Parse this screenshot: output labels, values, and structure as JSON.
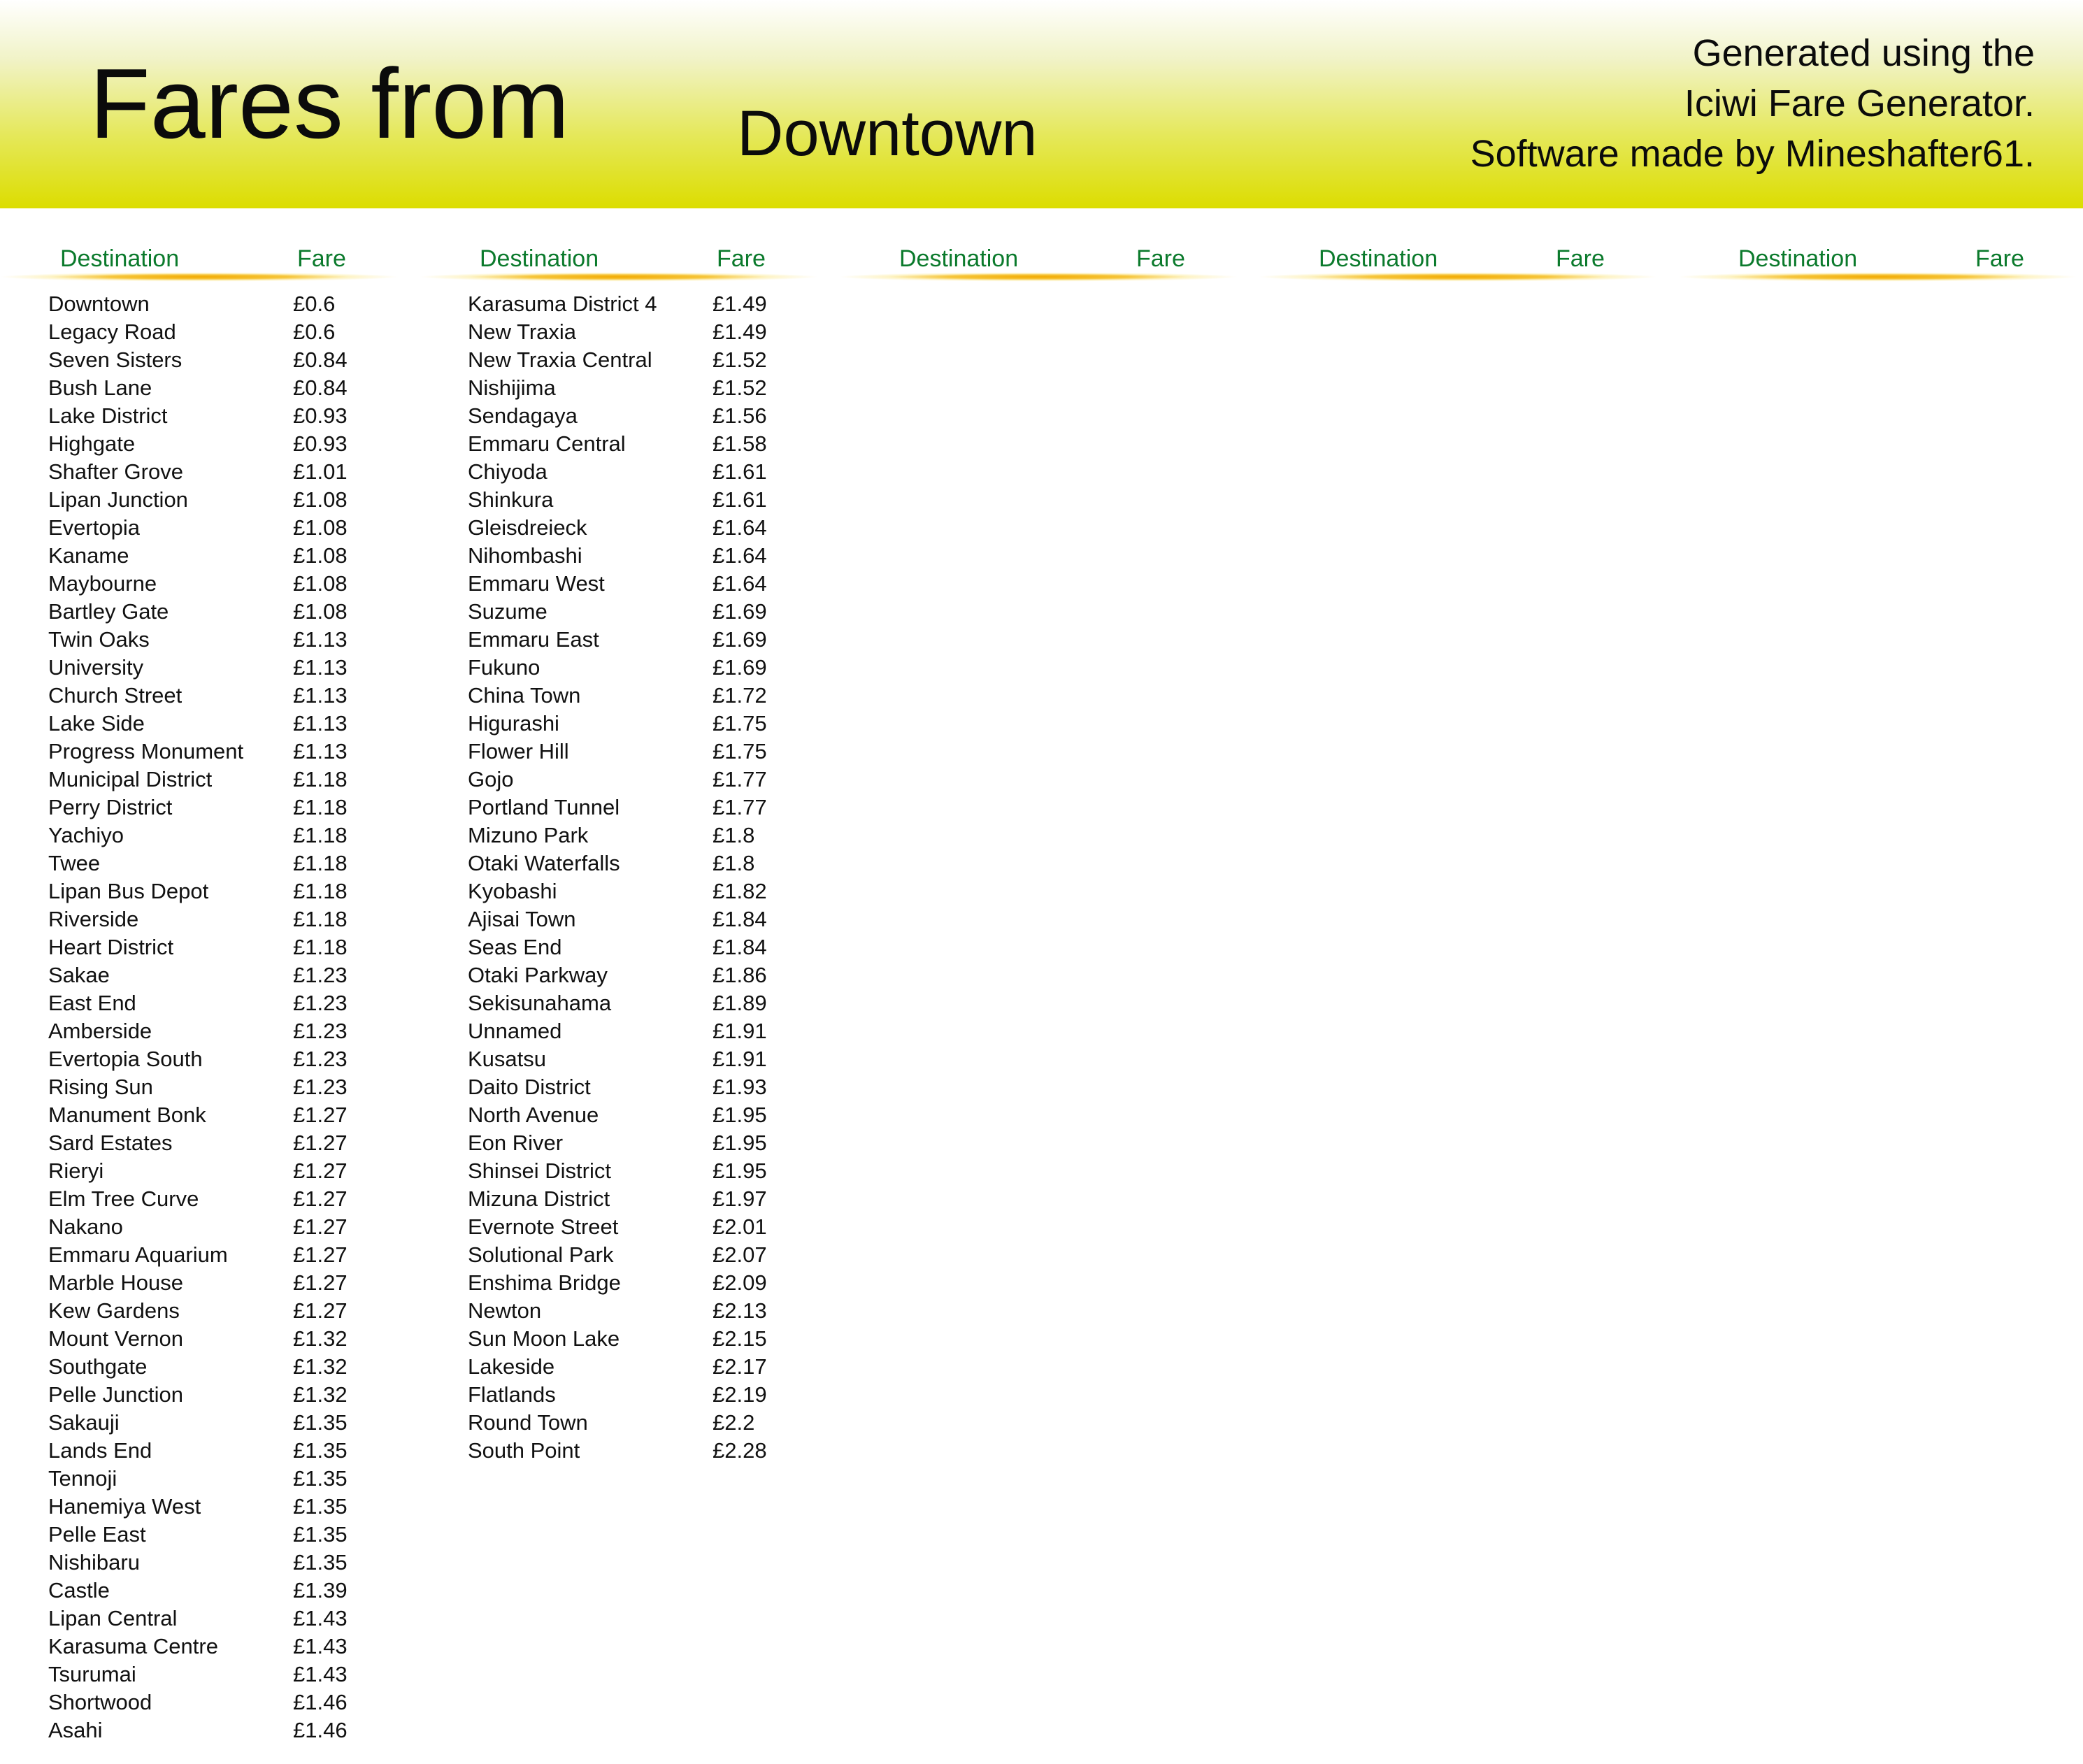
{
  "header": {
    "title": "Fares from",
    "station": "Downtown",
    "credit_lines": [
      "Generated using the",
      "Iciwi Fare Generator.",
      "Software made by Mineshafter61."
    ]
  },
  "columns": [
    {
      "dest_header": "Destination",
      "fare_header": "Fare",
      "rows": [
        {
          "dest": "Downtown",
          "fare": "£0.6"
        },
        {
          "dest": "Legacy Road",
          "fare": "£0.6"
        },
        {
          "dest": "Seven Sisters",
          "fare": "£0.84"
        },
        {
          "dest": "Bush Lane",
          "fare": "£0.84"
        },
        {
          "dest": "Lake District",
          "fare": "£0.93"
        },
        {
          "dest": "Highgate",
          "fare": "£0.93"
        },
        {
          "dest": "Shafter Grove",
          "fare": "£1.01"
        },
        {
          "dest": "Lipan Junction",
          "fare": "£1.08"
        },
        {
          "dest": "Evertopia",
          "fare": "£1.08"
        },
        {
          "dest": "Kaname",
          "fare": "£1.08"
        },
        {
          "dest": "Maybourne",
          "fare": "£1.08"
        },
        {
          "dest": "Bartley Gate",
          "fare": "£1.08"
        },
        {
          "dest": "Twin Oaks",
          "fare": "£1.13"
        },
        {
          "dest": "University",
          "fare": "£1.13"
        },
        {
          "dest": "Church Street",
          "fare": "£1.13"
        },
        {
          "dest": "Lake Side",
          "fare": "£1.13"
        },
        {
          "dest": "Progress Monument",
          "fare": "£1.13"
        },
        {
          "dest": "Municipal District",
          "fare": "£1.18"
        },
        {
          "dest": "Perry District",
          "fare": "£1.18"
        },
        {
          "dest": "Yachiyo",
          "fare": "£1.18"
        },
        {
          "dest": "Twee",
          "fare": "£1.18"
        },
        {
          "dest": "Lipan Bus Depot",
          "fare": "£1.18"
        },
        {
          "dest": "Riverside",
          "fare": "£1.18"
        },
        {
          "dest": "Heart District",
          "fare": "£1.18"
        },
        {
          "dest": "Sakae",
          "fare": "£1.23"
        },
        {
          "dest": "East End",
          "fare": "£1.23"
        },
        {
          "dest": "Amberside",
          "fare": "£1.23"
        },
        {
          "dest": "Evertopia South",
          "fare": "£1.23"
        },
        {
          "dest": "Rising Sun",
          "fare": "£1.23"
        },
        {
          "dest": "Manument Bonk",
          "fare": "£1.27"
        },
        {
          "dest": "Sard Estates",
          "fare": "£1.27"
        },
        {
          "dest": "Rieryi",
          "fare": "£1.27"
        },
        {
          "dest": "Elm Tree Curve",
          "fare": "£1.27"
        },
        {
          "dest": "Nakano",
          "fare": "£1.27"
        },
        {
          "dest": "Emmaru Aquarium",
          "fare": "£1.27"
        },
        {
          "dest": "Marble House",
          "fare": "£1.27"
        },
        {
          "dest": "Kew Gardens",
          "fare": "£1.27"
        },
        {
          "dest": "Mount Vernon",
          "fare": "£1.32"
        },
        {
          "dest": "Southgate",
          "fare": "£1.32"
        },
        {
          "dest": "Pelle Junction",
          "fare": "£1.32"
        },
        {
          "dest": "Sakauji",
          "fare": "£1.35"
        },
        {
          "dest": "Lands End",
          "fare": "£1.35"
        },
        {
          "dest": "Tennoji",
          "fare": "£1.35"
        },
        {
          "dest": "Hanemiya West",
          "fare": "£1.35"
        },
        {
          "dest": "Pelle East",
          "fare": "£1.35"
        },
        {
          "dest": "Nishibaru",
          "fare": "£1.35"
        },
        {
          "dest": "Castle",
          "fare": "£1.39"
        },
        {
          "dest": "Lipan Central",
          "fare": "£1.43"
        },
        {
          "dest": "Karasuma Centre",
          "fare": "£1.43"
        },
        {
          "dest": "Tsurumai",
          "fare": "£1.43"
        },
        {
          "dest": "Shortwood",
          "fare": "£1.46"
        },
        {
          "dest": "Asahi",
          "fare": "£1.46"
        }
      ]
    },
    {
      "dest_header": "Destination",
      "fare_header": "Fare",
      "rows": [
        {
          "dest": "Karasuma District 4",
          "fare": "£1.49"
        },
        {
          "dest": "New Traxia",
          "fare": "£1.49"
        },
        {
          "dest": "New Traxia Central",
          "fare": "£1.52"
        },
        {
          "dest": "Nishijima",
          "fare": "£1.52"
        },
        {
          "dest": "Sendagaya",
          "fare": "£1.56"
        },
        {
          "dest": "Emmaru Central",
          "fare": "£1.58"
        },
        {
          "dest": "Chiyoda",
          "fare": "£1.61"
        },
        {
          "dest": "Shinkura",
          "fare": "£1.61"
        },
        {
          "dest": "Gleisdreieck",
          "fare": "£1.64"
        },
        {
          "dest": "Nihombashi",
          "fare": "£1.64"
        },
        {
          "dest": "Emmaru West",
          "fare": "£1.64"
        },
        {
          "dest": "Suzume",
          "fare": "£1.69"
        },
        {
          "dest": "Emmaru East",
          "fare": "£1.69"
        },
        {
          "dest": "Fukuno",
          "fare": "£1.69"
        },
        {
          "dest": "China Town",
          "fare": "£1.72"
        },
        {
          "dest": "Higurashi",
          "fare": "£1.75"
        },
        {
          "dest": "Flower Hill",
          "fare": "£1.75"
        },
        {
          "dest": "Gojo",
          "fare": "£1.77"
        },
        {
          "dest": "Portland Tunnel",
          "fare": "£1.77"
        },
        {
          "dest": "Mizuno Park",
          "fare": "£1.8"
        },
        {
          "dest": "Otaki Waterfalls",
          "fare": "£1.8"
        },
        {
          "dest": "Kyobashi",
          "fare": "£1.82"
        },
        {
          "dest": "Ajisai Town",
          "fare": "£1.84"
        },
        {
          "dest": "Seas End",
          "fare": "£1.84"
        },
        {
          "dest": "Otaki Parkway",
          "fare": "£1.86"
        },
        {
          "dest": "Sekisunahama",
          "fare": "£1.89"
        },
        {
          "dest": "Unnamed",
          "fare": "£1.91"
        },
        {
          "dest": "Kusatsu",
          "fare": "£1.91"
        },
        {
          "dest": "Daito District",
          "fare": "£1.93"
        },
        {
          "dest": "North Avenue",
          "fare": "£1.95"
        },
        {
          "dest": "Eon River",
          "fare": "£1.95"
        },
        {
          "dest": "Shinsei District",
          "fare": "£1.95"
        },
        {
          "dest": "Mizuna District",
          "fare": "£1.97"
        },
        {
          "dest": "Evernote Street",
          "fare": "£2.01"
        },
        {
          "dest": "Solutional Park",
          "fare": "£2.07"
        },
        {
          "dest": "Enshima Bridge",
          "fare": "£2.09"
        },
        {
          "dest": "Newton",
          "fare": "£2.13"
        },
        {
          "dest": "Sun Moon Lake",
          "fare": "£2.15"
        },
        {
          "dest": "Lakeside",
          "fare": "£2.17"
        },
        {
          "dest": "Flatlands",
          "fare": "£2.19"
        },
        {
          "dest": "Round Town",
          "fare": "£2.2"
        },
        {
          "dest": "South Point",
          "fare": "£2.28"
        }
      ]
    },
    {
      "dest_header": "Destination",
      "fare_header": "Fare",
      "rows": []
    },
    {
      "dest_header": "Destination",
      "fare_header": "Fare",
      "rows": []
    },
    {
      "dest_header": "Destination",
      "fare_header": "Fare",
      "rows": []
    }
  ],
  "colors": {
    "header_gradient_end": "#dcdd00",
    "column_header_text": "#0b7a2c",
    "swoosh_accent": "#f2a900",
    "body_text": "#111111"
  }
}
